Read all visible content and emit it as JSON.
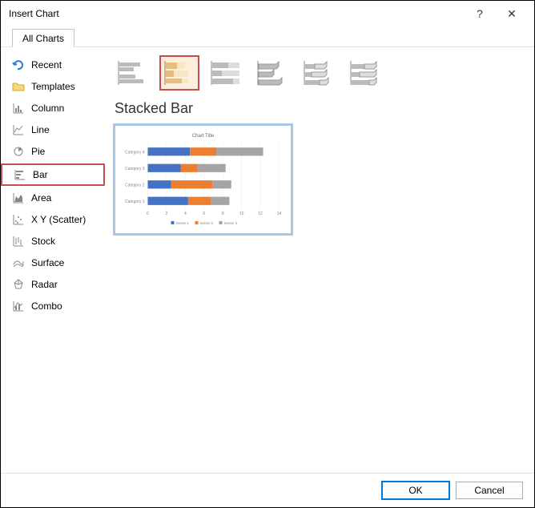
{
  "dialog": {
    "title": "Insert Chart"
  },
  "tab": {
    "label": "All Charts"
  },
  "categories": [
    {
      "id": "recent",
      "label": "Recent"
    },
    {
      "id": "templates",
      "label": "Templates"
    },
    {
      "id": "column",
      "label": "Column"
    },
    {
      "id": "line",
      "label": "Line"
    },
    {
      "id": "pie",
      "label": "Pie"
    },
    {
      "id": "bar",
      "label": "Bar",
      "selected": true
    },
    {
      "id": "area",
      "label": "Area"
    },
    {
      "id": "scatter",
      "label": "X Y (Scatter)"
    },
    {
      "id": "stock",
      "label": "Stock"
    },
    {
      "id": "surface",
      "label": "Surface"
    },
    {
      "id": "radar",
      "label": "Radar"
    },
    {
      "id": "combo",
      "label": "Combo"
    }
  ],
  "subtype": {
    "selected_index": 1,
    "selected_label": "Stacked Bar"
  },
  "preview": {
    "title": "Chart Title",
    "legend": [
      "Series 1",
      "Series 2",
      "Series 3"
    ]
  },
  "chart_data": {
    "type": "bar",
    "orientation": "horizontal",
    "stacked": true,
    "categories": [
      "Category 4",
      "Category 3",
      "Category 2",
      "Category 1"
    ],
    "series": [
      {
        "name": "Series 1",
        "values": [
          4.5,
          3.5,
          2.5,
          4.3
        ],
        "color": "#4472c4"
      },
      {
        "name": "Series 2",
        "values": [
          2.8,
          1.8,
          4.4,
          2.4
        ],
        "color": "#ed7d31"
      },
      {
        "name": "Series 3",
        "values": [
          5.0,
          3.0,
          2.0,
          2.0
        ],
        "color": "#a5a5a5"
      }
    ],
    "xlim": [
      0,
      14
    ],
    "xticks": [
      0,
      2,
      4,
      6,
      8,
      10,
      12,
      14
    ],
    "title": "Chart Title"
  },
  "buttons": {
    "ok": "OK",
    "cancel": "Cancel"
  }
}
